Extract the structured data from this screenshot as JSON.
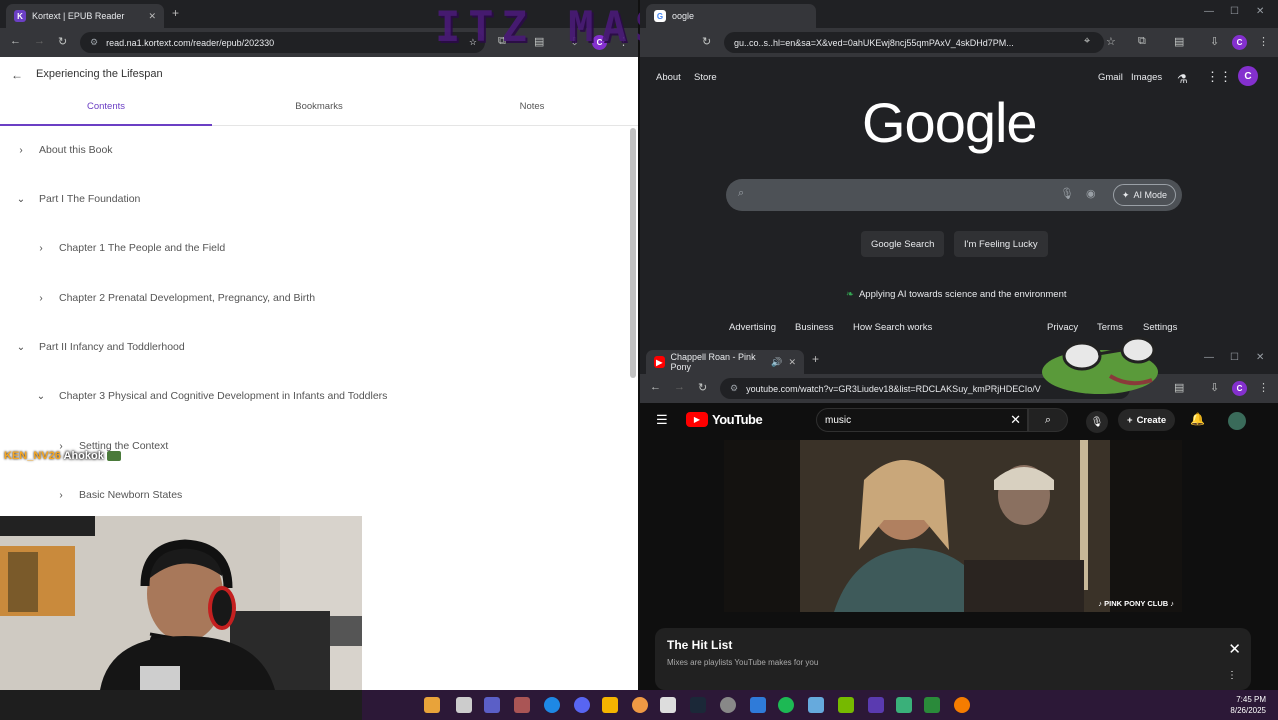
{
  "left_window": {
    "tab_title": "Kortext | EPUB Reader",
    "url": "read.na1.kortext.com/reader/epub/202330",
    "book_title": "Experiencing the Lifespan",
    "tabs": [
      "Contents",
      "Bookmarks",
      "Notes"
    ],
    "toc": [
      {
        "label": "About this Book",
        "level": 0,
        "expanded": false
      },
      {
        "label": "Part I The Foundation",
        "level": 0,
        "expanded": true
      },
      {
        "label": "Chapter 1 The People and the Field",
        "level": 1,
        "expanded": false
      },
      {
        "label": "Chapter 2 Prenatal Development, Pregnancy, and Birth",
        "level": 1,
        "expanded": false
      },
      {
        "label": "Part II Infancy and Toddlerhood",
        "level": 0,
        "expanded": true
      },
      {
        "label": "Chapter 3 Physical and Cognitive Development in Infants and Toddlers",
        "level": 1,
        "expanded": true
      },
      {
        "label": "Setting the Context",
        "level": 2,
        "expanded": false
      },
      {
        "label": "Basic Newborn States",
        "level": 2,
        "expanded": false
      }
    ]
  },
  "stream_overlay": {
    "watermark": "ITZ MASH",
    "chat_user": "KEN_NV26",
    "chat_message": "Ahokok"
  },
  "google_window": {
    "tab_title": "oogle",
    "url": "gu..co..s..hl=en&sa=X&ved=0ahUKEwj8ncj55qmPAxV_4skDHd7PM...",
    "nav_left": [
      "About",
      "Store"
    ],
    "nav_right": [
      "Gmail",
      "Images"
    ],
    "profile_initial": "C",
    "logo": "Google",
    "ai_mode_label": "AI Mode",
    "buttons": [
      "Google Search",
      "I'm Feeling Lucky"
    ],
    "promo": "Applying AI towards science and the environment",
    "footer_left": [
      "Advertising",
      "Business",
      "How Search works"
    ],
    "footer_right": [
      "Privacy",
      "Terms",
      "Settings"
    ]
  },
  "youtube_window": {
    "tab_title": "Chappell Roan - Pink Pony",
    "url": "youtube.com/watch?v=GR3Liudev18&list=RDCLAKSuy_kmPRjHDECIo/V",
    "brand": "YouTube",
    "search_value": "music",
    "create_label": "Create",
    "video_caption": "♪ PINK PONY CLUB ♪",
    "hitlist_title": "The Hit List",
    "hitlist_subtitle": "Mixes are playlists YouTube makes for you"
  },
  "taskbar": {
    "time": "7:45 PM",
    "date": "8/26/2025"
  },
  "colors": {
    "accent_purple": "#6b3fc4",
    "chrome_dark": "#202124",
    "youtube_red": "#ff0000",
    "taskbar": "#2c1837"
  }
}
